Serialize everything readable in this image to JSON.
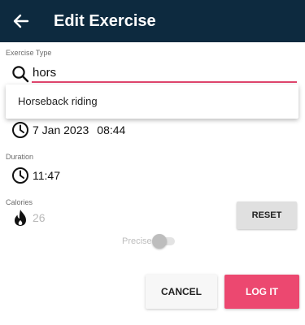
{
  "app_bar": {
    "title": "Edit Exercise",
    "back_icon": "arrow-left-icon",
    "background": "#0d2a3f"
  },
  "exercise_type": {
    "label": "Exercise Type",
    "value": "hors",
    "icon": "search-icon",
    "accent": "#e0456d"
  },
  "suggestions": [
    {
      "label": "Horseback riding"
    }
  ],
  "date_time": {
    "icon": "clock-icon",
    "date": "7 Jan 2023",
    "time": "08:44"
  },
  "duration": {
    "label": "Duration",
    "icon": "clock-icon",
    "value": "11:47"
  },
  "calories": {
    "label": "Calories",
    "icon": "flame-icon",
    "value": "26"
  },
  "reset_label": "RESET",
  "precise": {
    "label": "Precise",
    "on": false
  },
  "actions": {
    "cancel_label": "CANCEL",
    "log_label": "LOG IT",
    "log_color": "#ec4870"
  }
}
